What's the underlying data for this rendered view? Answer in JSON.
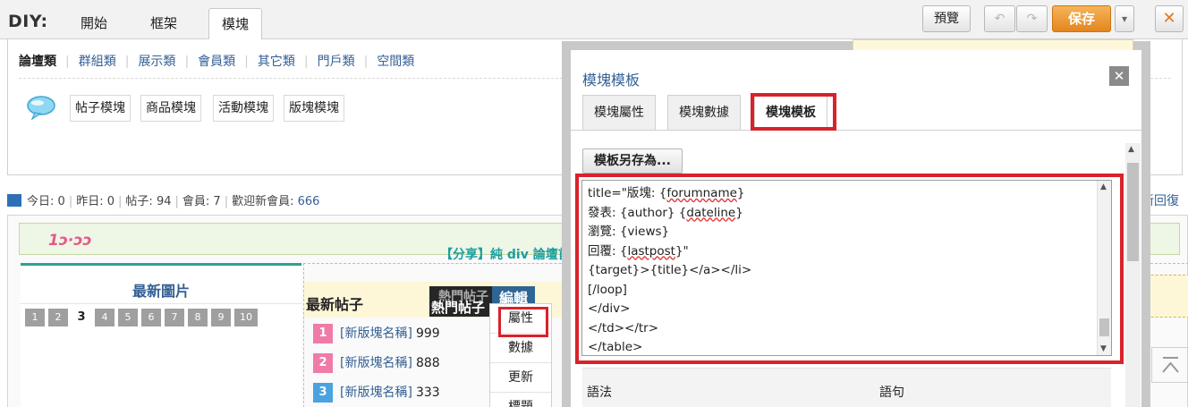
{
  "diy_bar": {
    "label": "DIY:",
    "tabs": [
      {
        "label": "開始"
      },
      {
        "label": "框架"
      },
      {
        "label": "模塊",
        "active": true
      }
    ],
    "preview_label": "預覽",
    "undo_icon": "↶",
    "redo_icon": "↷",
    "save_label": "保存",
    "dropdown_icon": "▾",
    "close_icon": "✕"
  },
  "palette": {
    "categories": [
      "論壇類",
      "群組類",
      "展示類",
      "會員類",
      "其它類",
      "門戶類",
      "空間類"
    ],
    "active_category": "論壇類",
    "modules": [
      "帖子模塊",
      "商品模塊",
      "活動模塊",
      "版塊模塊"
    ]
  },
  "stats": {
    "today_label": "今日:",
    "today": "0",
    "yesterday_label": "昨日:",
    "yesterday": "0",
    "posts_label": "帖子:",
    "posts": "94",
    "members_label": "會員:",
    "members": "7",
    "welcome_label": "歡迎新會員:",
    "welcome": "666",
    "reply_link": "新回復"
  },
  "preview": {
    "logo": "1ɔ·ɔɔ",
    "banner_text": "【分享】純 div 論壇首",
    "left_title": "最新圖片",
    "pages": [
      "1",
      "2",
      "3",
      "4",
      "5",
      "6",
      "7",
      "8",
      "9",
      "10"
    ],
    "current_page": "3",
    "mid_title": "最新帖子",
    "hot_ghost": "熱門帖子",
    "hot_label": "熱門帖子",
    "edit_label": "編輯",
    "posts": [
      {
        "rank": "1",
        "name": "[新版塊名稱]",
        "value": "999",
        "color": "#f07aa8"
      },
      {
        "rank": "2",
        "name": "[新版塊名稱]",
        "value": "888",
        "color": "#f07aa8"
      },
      {
        "rank": "3",
        "name": "[新版塊名稱]",
        "value": "333",
        "color": "#4aa3e0"
      }
    ],
    "menu": [
      "屬性",
      "數據",
      "更新",
      "標題"
    ]
  },
  "dialog": {
    "title": "模塊模板",
    "close_icon": "✕",
    "tabs": [
      "模塊屬性",
      "模塊數據",
      "模塊模板"
    ],
    "active_tab": "模塊模板",
    "save_as_label": "模板另存為...",
    "code_lines": [
      "title=\"版塊: {forumname}",
      "發表: {author} {dateline}",
      "瀏覽: {views}",
      "回覆: {lastpost}\"",
      "{target}>{title}</a></li>",
      "[/loop]",
      "</div>",
      "</td></tr>",
      "</table>"
    ],
    "syntax_header": {
      "col1": "語法",
      "col2": "語句"
    }
  },
  "colors": {
    "accent_orange": "#e2861d",
    "link_blue": "#335f95",
    "highlight_red": "#d9222a",
    "teal": "#2f9f96"
  }
}
